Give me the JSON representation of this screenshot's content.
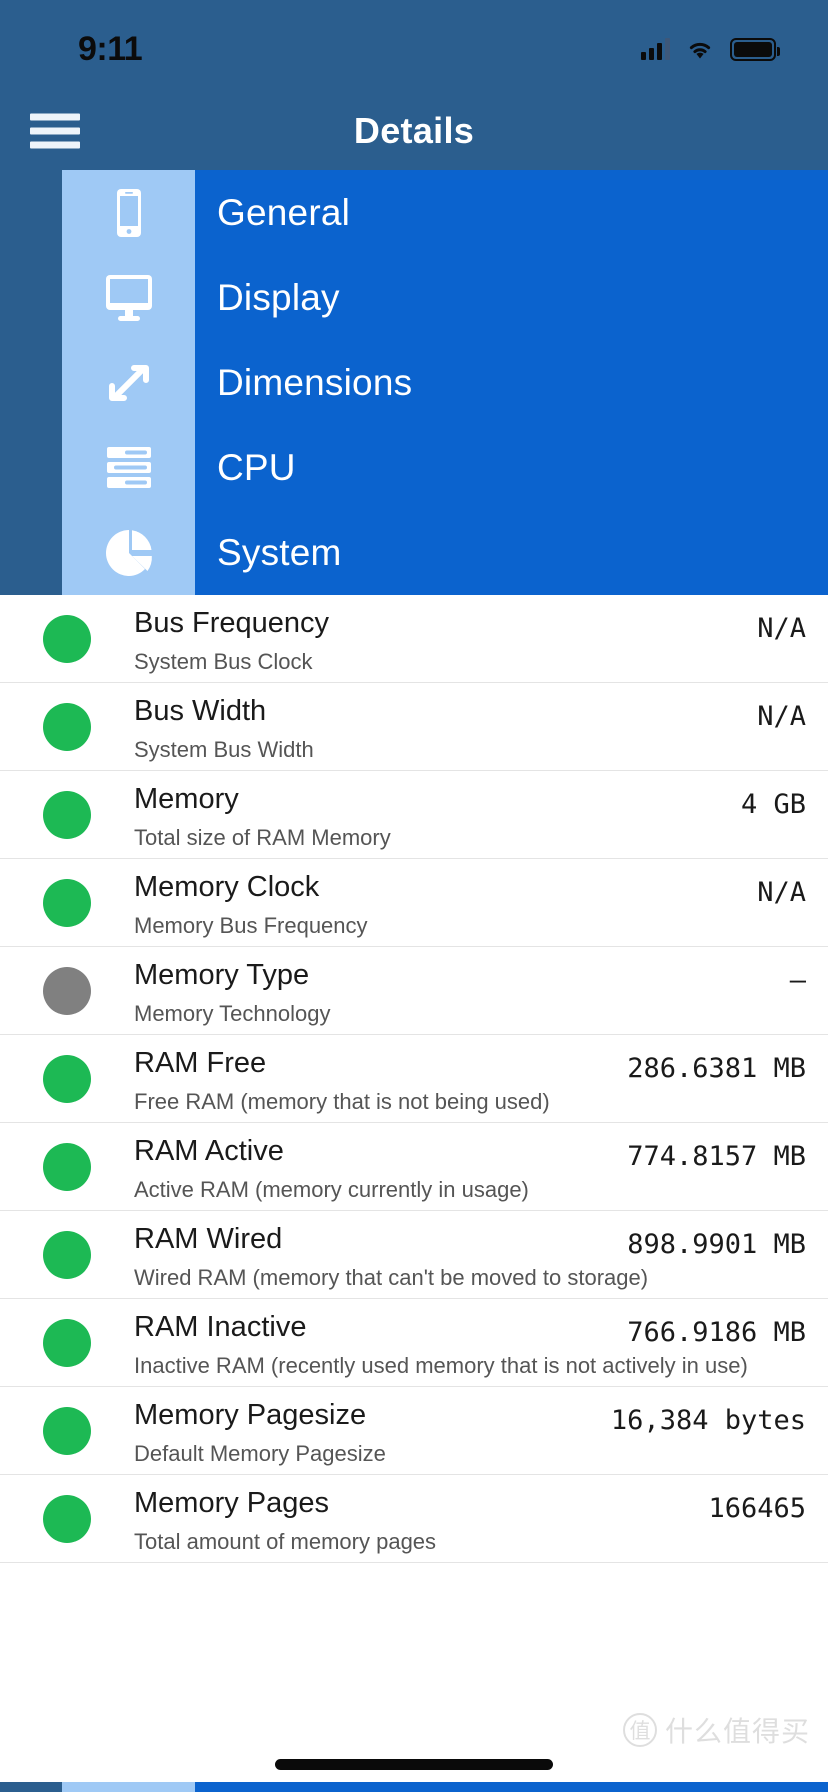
{
  "status_bar": {
    "time": "9:11",
    "icons": [
      "cellular-signal-icon",
      "wifi-icon",
      "battery-icon"
    ]
  },
  "nav": {
    "menu_icon": "hamburger-menu-icon",
    "title": "Details"
  },
  "tabs": [
    {
      "label": "General",
      "icon": "phone-icon"
    },
    {
      "label": "Display",
      "icon": "monitor-icon"
    },
    {
      "label": "Dimensions",
      "icon": "expand-arrows-icon"
    },
    {
      "label": "CPU",
      "icon": "server-icon"
    },
    {
      "label": "System",
      "icon": "pie-chart-icon"
    }
  ],
  "colors": {
    "header_blue": "#2B5E8E",
    "tab_icon_blue": "#9FC9F5",
    "tab_label_blue": "#0B63CE",
    "status_ok": "#1DB954",
    "status_na": "#808080"
  },
  "rows": [
    {
      "title": "Bus Frequency",
      "subtitle": "System Bus Clock",
      "value": "N/A",
      "status": "ok"
    },
    {
      "title": "Bus Width",
      "subtitle": "System Bus Width",
      "value": "N/A",
      "status": "ok"
    },
    {
      "title": "Memory",
      "subtitle": "Total size of RAM Memory",
      "value": "4  GB",
      "status": "ok"
    },
    {
      "title": "Memory Clock",
      "subtitle": "Memory Bus Frequency",
      "value": "N/A",
      "status": "ok"
    },
    {
      "title": "Memory Type",
      "subtitle": "Memory Technology",
      "value": "–",
      "status": "na"
    },
    {
      "title": "RAM Free",
      "subtitle": "Free RAM (memory that is not being used)",
      "value": "286.6381  MB",
      "status": "ok"
    },
    {
      "title": "RAM Active",
      "subtitle": "Active RAM (memory currently in usage)",
      "value": "774.8157  MB",
      "status": "ok"
    },
    {
      "title": "RAM Wired",
      "subtitle": "Wired RAM (memory that can't be moved to storage)",
      "value": "898.9901  MB",
      "status": "ok"
    },
    {
      "title": "RAM Inactive",
      "subtitle": "Inactive RAM (recently used memory that is not actively in use)",
      "value": "766.9186  MB",
      "status": "ok"
    },
    {
      "title": "Memory Pagesize",
      "subtitle": "Default Memory Pagesize",
      "value": "16,384 bytes",
      "status": "ok"
    },
    {
      "title": "Memory Pages",
      "subtitle": "Total amount of memory pages",
      "value": "166465",
      "status": "ok"
    }
  ],
  "watermark": {
    "badge": "值",
    "text": "什么值得买"
  }
}
